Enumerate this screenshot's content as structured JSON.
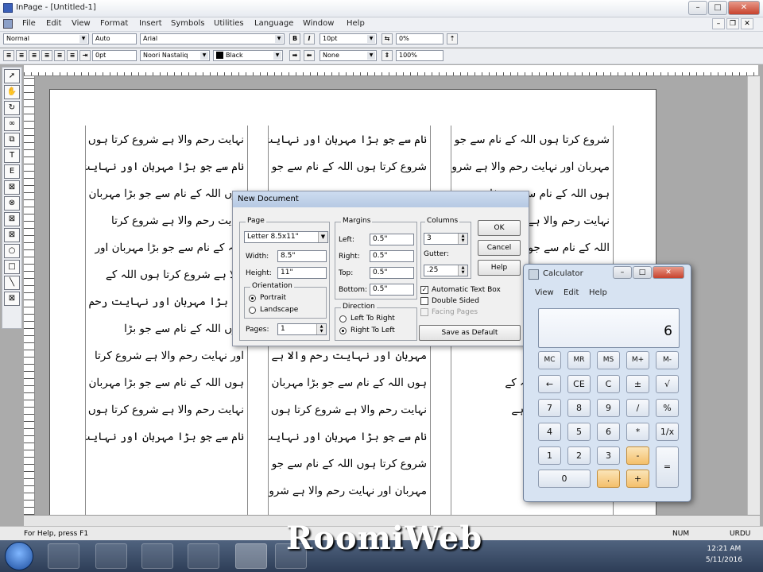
{
  "window": {
    "title": "InPage - [Untitled-1]"
  },
  "menu": [
    "File",
    "Edit",
    "View",
    "Format",
    "Insert",
    "Symbols",
    "Utilities",
    "Language",
    "Window",
    "Help"
  ],
  "toolbar1": {
    "style": "Normal",
    "auto": "Auto",
    "font": "Arial",
    "bold": "B",
    "italic": "I",
    "size": "10pt",
    "percent": "0%"
  },
  "toolbar2": {
    "spacing": "0pt",
    "urdu_font": "Noori Nastaliq",
    "color": "Black",
    "none": "None",
    "scale": "100%"
  },
  "page_text": {
    "col1": [
      "نہایت رحم والا ہے   شروع کرتا ہوں اللہ کے",
      "نام سے جو بڑا مہربان اور نہایت رحم والا ہے",
      "ہوں اللہ کے نام سے جو بڑا مہربان اور",
      "نہایت رحم والا ہے شروع کرتا",
      "اللہ کے نام سے جو بڑا مہربان اور",
      "والا ہے شروع کرتا ہوں اللہ کے",
      "جو بڑا مہربان اور نہایت رحم والا ہے",
      "ہوں اللہ کے نام سے جو بڑا",
      "اور نہایت رحم والا ہے شروع کرتا",
      "ہوں اللہ کے نام سے جو بڑا مہربان اور",
      "نہایت رحم والا ہے شروع کرتا ہوں اللہ کے",
      "نام سے جو بڑا مہربان اور نہایت رحم والا ہے"
    ],
    "col2": [
      "نام سے جو بڑا مہربان اور نہایت رحم والا ہے",
      "شروع کرتا ہوں اللہ کے نام سے جو بڑا",
      "",
      "",
      "",
      "",
      "",
      "",
      "مہربان اور نہایت رحم والا ہے",
      "ہوں اللہ کے نام سے جو بڑا مہربان اور",
      "نہایت رحم والا ہے شروع کرتا ہوں اللہ کے",
      "نام سے جو بڑا مہربان اور نہایت رحم والا ہے",
      "شروع کرتا ہوں اللہ کے نام سے جو بڑا",
      "مہربان اور نہایت رحم والا ہے شروع کرتا"
    ],
    "col3": [
      "شروع کرتا ہوں اللہ کے نام سے جو بڑا",
      "مہربان اور نہایت رحم والا ہے شروع کرتا",
      "ہوں اللہ کے نام سے جو بڑا",
      "نہایت رحم والا ہے شروع کرتا",
      "اللہ کے نام سے جو بڑا مہربان اور",
      "",
      "",
      "",
      "ہوں اللہ کے نام",
      "شروع کرتا ہوں اللہ کے",
      "نہایت رحم والا ہے",
      "نام سے جو بڑا",
      "شروع کرتا ہوں",
      "مہربان اور"
    ]
  },
  "new_document": {
    "title": "New Document",
    "page_group": "Page",
    "page_size": "Letter 8.5x11\"",
    "width_label": "Width:",
    "width": "8.5\"",
    "height_label": "Height:",
    "height": "11\"",
    "orientation_group": "Orientation",
    "portrait": "Portrait",
    "landscape": "Landscape",
    "pages_label": "Pages:",
    "pages": "1",
    "margins_group": "Margins",
    "left_label": "Left:",
    "left": "0.5\"",
    "right_label": "Right:",
    "right": "0.5\"",
    "top_label": "Top:",
    "top": "0.5\"",
    "bottom_label": "Bottom:",
    "bottom": "0.5\"",
    "direction_group": "Direction",
    "ltr": "Left To Right",
    "rtl": "Right To Left",
    "columns_group": "Columns",
    "columns": "3",
    "gutter_label": "Gutter:",
    "gutter": ".25",
    "auto_text_box": "Automatic Text Box",
    "double_sided": "Double Sided",
    "facing_pages": "Facing Pages",
    "save_default": "Save as Default",
    "ok": "OK",
    "cancel": "Cancel",
    "help": "Help"
  },
  "calculator": {
    "title": "Calculator",
    "menu": [
      "View",
      "Edit",
      "Help"
    ],
    "display": "6",
    "row_mem": [
      "MC",
      "MR",
      "MS",
      "M+",
      "M-"
    ],
    "row1": [
      "←",
      "CE",
      "C",
      "±",
      "√"
    ],
    "row2": [
      "7",
      "8",
      "9",
      "/",
      "%"
    ],
    "row3": [
      "4",
      "5",
      "6",
      "*",
      "1/x"
    ],
    "row4": [
      "1",
      "2",
      "3",
      "-"
    ],
    "zero": "0",
    "dot": ".",
    "plus": "+",
    "equals": "="
  },
  "status": {
    "help": "For Help, press F1",
    "num": "NUM",
    "lang": "URDU"
  },
  "watermark": "RoomiWeb",
  "clock": {
    "time": "12:21 AM",
    "date": "5/11/2016"
  }
}
